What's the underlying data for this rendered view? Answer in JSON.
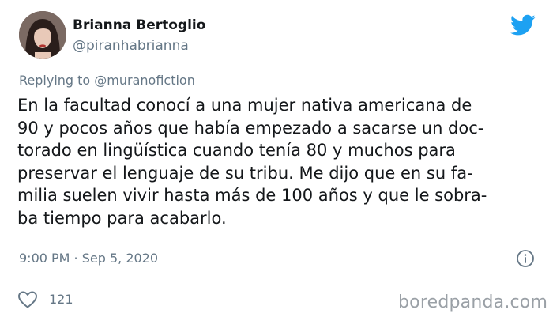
{
  "tweet": {
    "author_name": "Brianna Bertoglio",
    "author_handle": "@piranhabrianna",
    "reply_prefix": "Replying to",
    "reply_to": "@muranofiction",
    "text_lines": [
      "En la facultad conocí a una mujer nativa americana de",
      "90 y pocos años que había empezado a sacarse un doc-",
      "torado en lingüística cuando tenía 80 y muchos para",
      "preservar el lenguaje de su tribu. Me dijo que en su fa-",
      "milia suelen vivir hasta más de 100 años y que le sobra-",
      "ba tiempo para acabarlo."
    ],
    "timestamp": "9:00 PM · Sep 5, 2020",
    "like_count": "121"
  },
  "icons": {
    "brand": "twitter-bird-icon",
    "info": "info-icon",
    "like": "heart-icon"
  },
  "watermark": "boredpanda.com",
  "colors": {
    "twitter_blue": "#1da1f2",
    "text": "#14171a",
    "secondary_text": "#657786",
    "divider": "#e1e8ed",
    "watermark": "#9aa0a6"
  }
}
